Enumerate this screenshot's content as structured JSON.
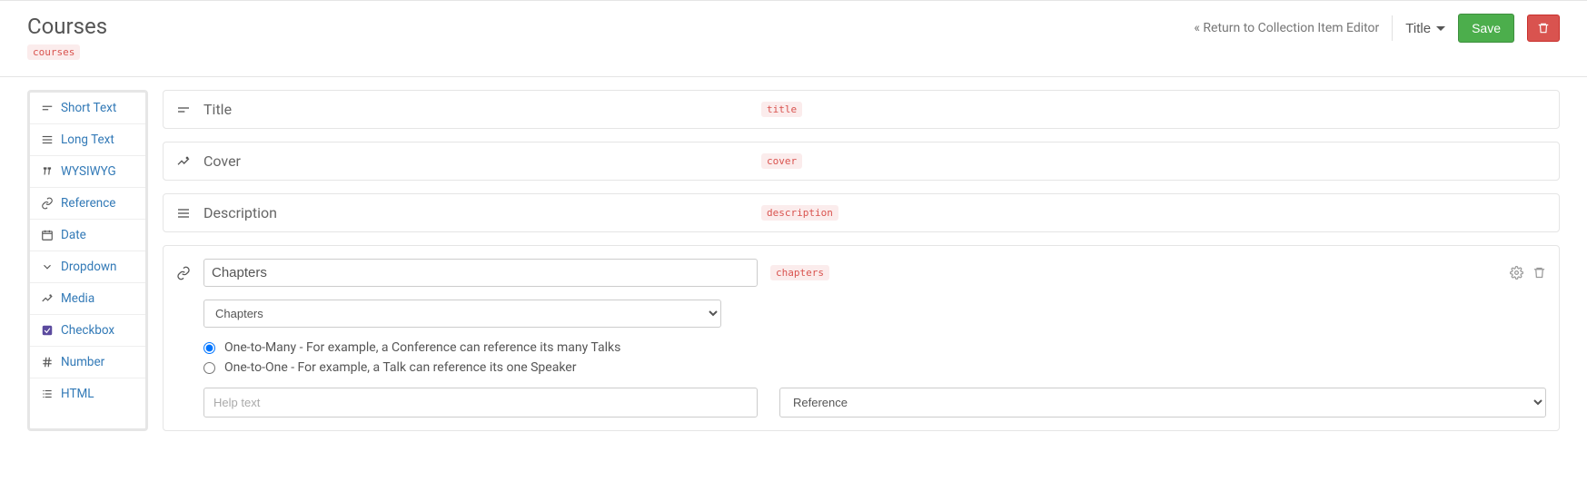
{
  "header": {
    "title": "Courses",
    "slug": "courses",
    "return_link": "« Return to Collection Item Editor",
    "title_dropdown": "Title",
    "save_label": "Save"
  },
  "sidebar": {
    "items": [
      {
        "icon": "short-text",
        "label": "Short Text"
      },
      {
        "icon": "long-text",
        "label": "Long Text"
      },
      {
        "icon": "wysiwyg",
        "label": "WYSIWYG"
      },
      {
        "icon": "reference",
        "label": "Reference"
      },
      {
        "icon": "date",
        "label": "Date"
      },
      {
        "icon": "dropdown",
        "label": "Dropdown"
      },
      {
        "icon": "media",
        "label": "Media"
      },
      {
        "icon": "checkbox",
        "label": "Checkbox"
      },
      {
        "icon": "number",
        "label": "Number"
      },
      {
        "icon": "html",
        "label": "HTML"
      }
    ]
  },
  "fields": [
    {
      "icon": "short-text",
      "label": "Title",
      "slug": "title"
    },
    {
      "icon": "media",
      "label": "Cover",
      "slug": "cover"
    },
    {
      "icon": "long-text",
      "label": "Description",
      "slug": "description"
    }
  ],
  "editing_field": {
    "icon": "reference",
    "name_value": "Chapters",
    "slug": "chapters",
    "collection_select_value": "Chapters",
    "relation_options": [
      {
        "label": "One-to-Many - For example, a Conference can reference its many Talks",
        "checked": true
      },
      {
        "label": "One-to-One - For example, a Talk can reference its one Speaker",
        "checked": false
      }
    ],
    "help_placeholder": "Help text",
    "help_value": "",
    "reference_select_value": "Reference"
  }
}
